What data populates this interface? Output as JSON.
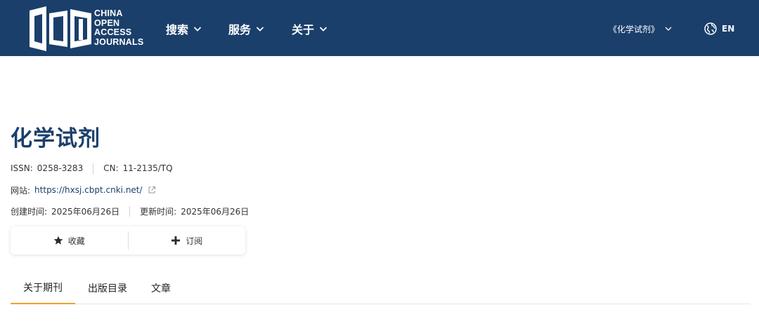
{
  "header": {
    "logo_lines": [
      "CHINA",
      "OPEN",
      "ACCESS",
      "JOURNALS"
    ],
    "nav": [
      {
        "label": "搜索",
        "icon": "chevron-down-icon"
      },
      {
        "label": "服务",
        "icon": "chevron-down-icon"
      },
      {
        "label": "关于",
        "icon": "chevron-down-icon"
      }
    ],
    "journal_select": "《化学试剂》",
    "language": "EN",
    "bg_color": "#1a3f6b"
  },
  "journal": {
    "title": "化学试剂",
    "issn_label": "ISSN:",
    "issn": "0258-3283",
    "cn_label": "CN:",
    "cn": "11-2135/TQ",
    "site_label": "网站:",
    "site_url": "https://hxsj.cbpt.cnki.net/",
    "created_label": "创建时间:",
    "created": "2025年06月26日",
    "updated_label": "更新时间:",
    "updated": "2025年06月26日"
  },
  "actions": {
    "favorite": "收藏",
    "subscribe": "订阅"
  },
  "tabs": [
    "关于期刊",
    "出版目录",
    "文章"
  ],
  "active_tab": "关于期刊",
  "accent_color": "#f0a030"
}
